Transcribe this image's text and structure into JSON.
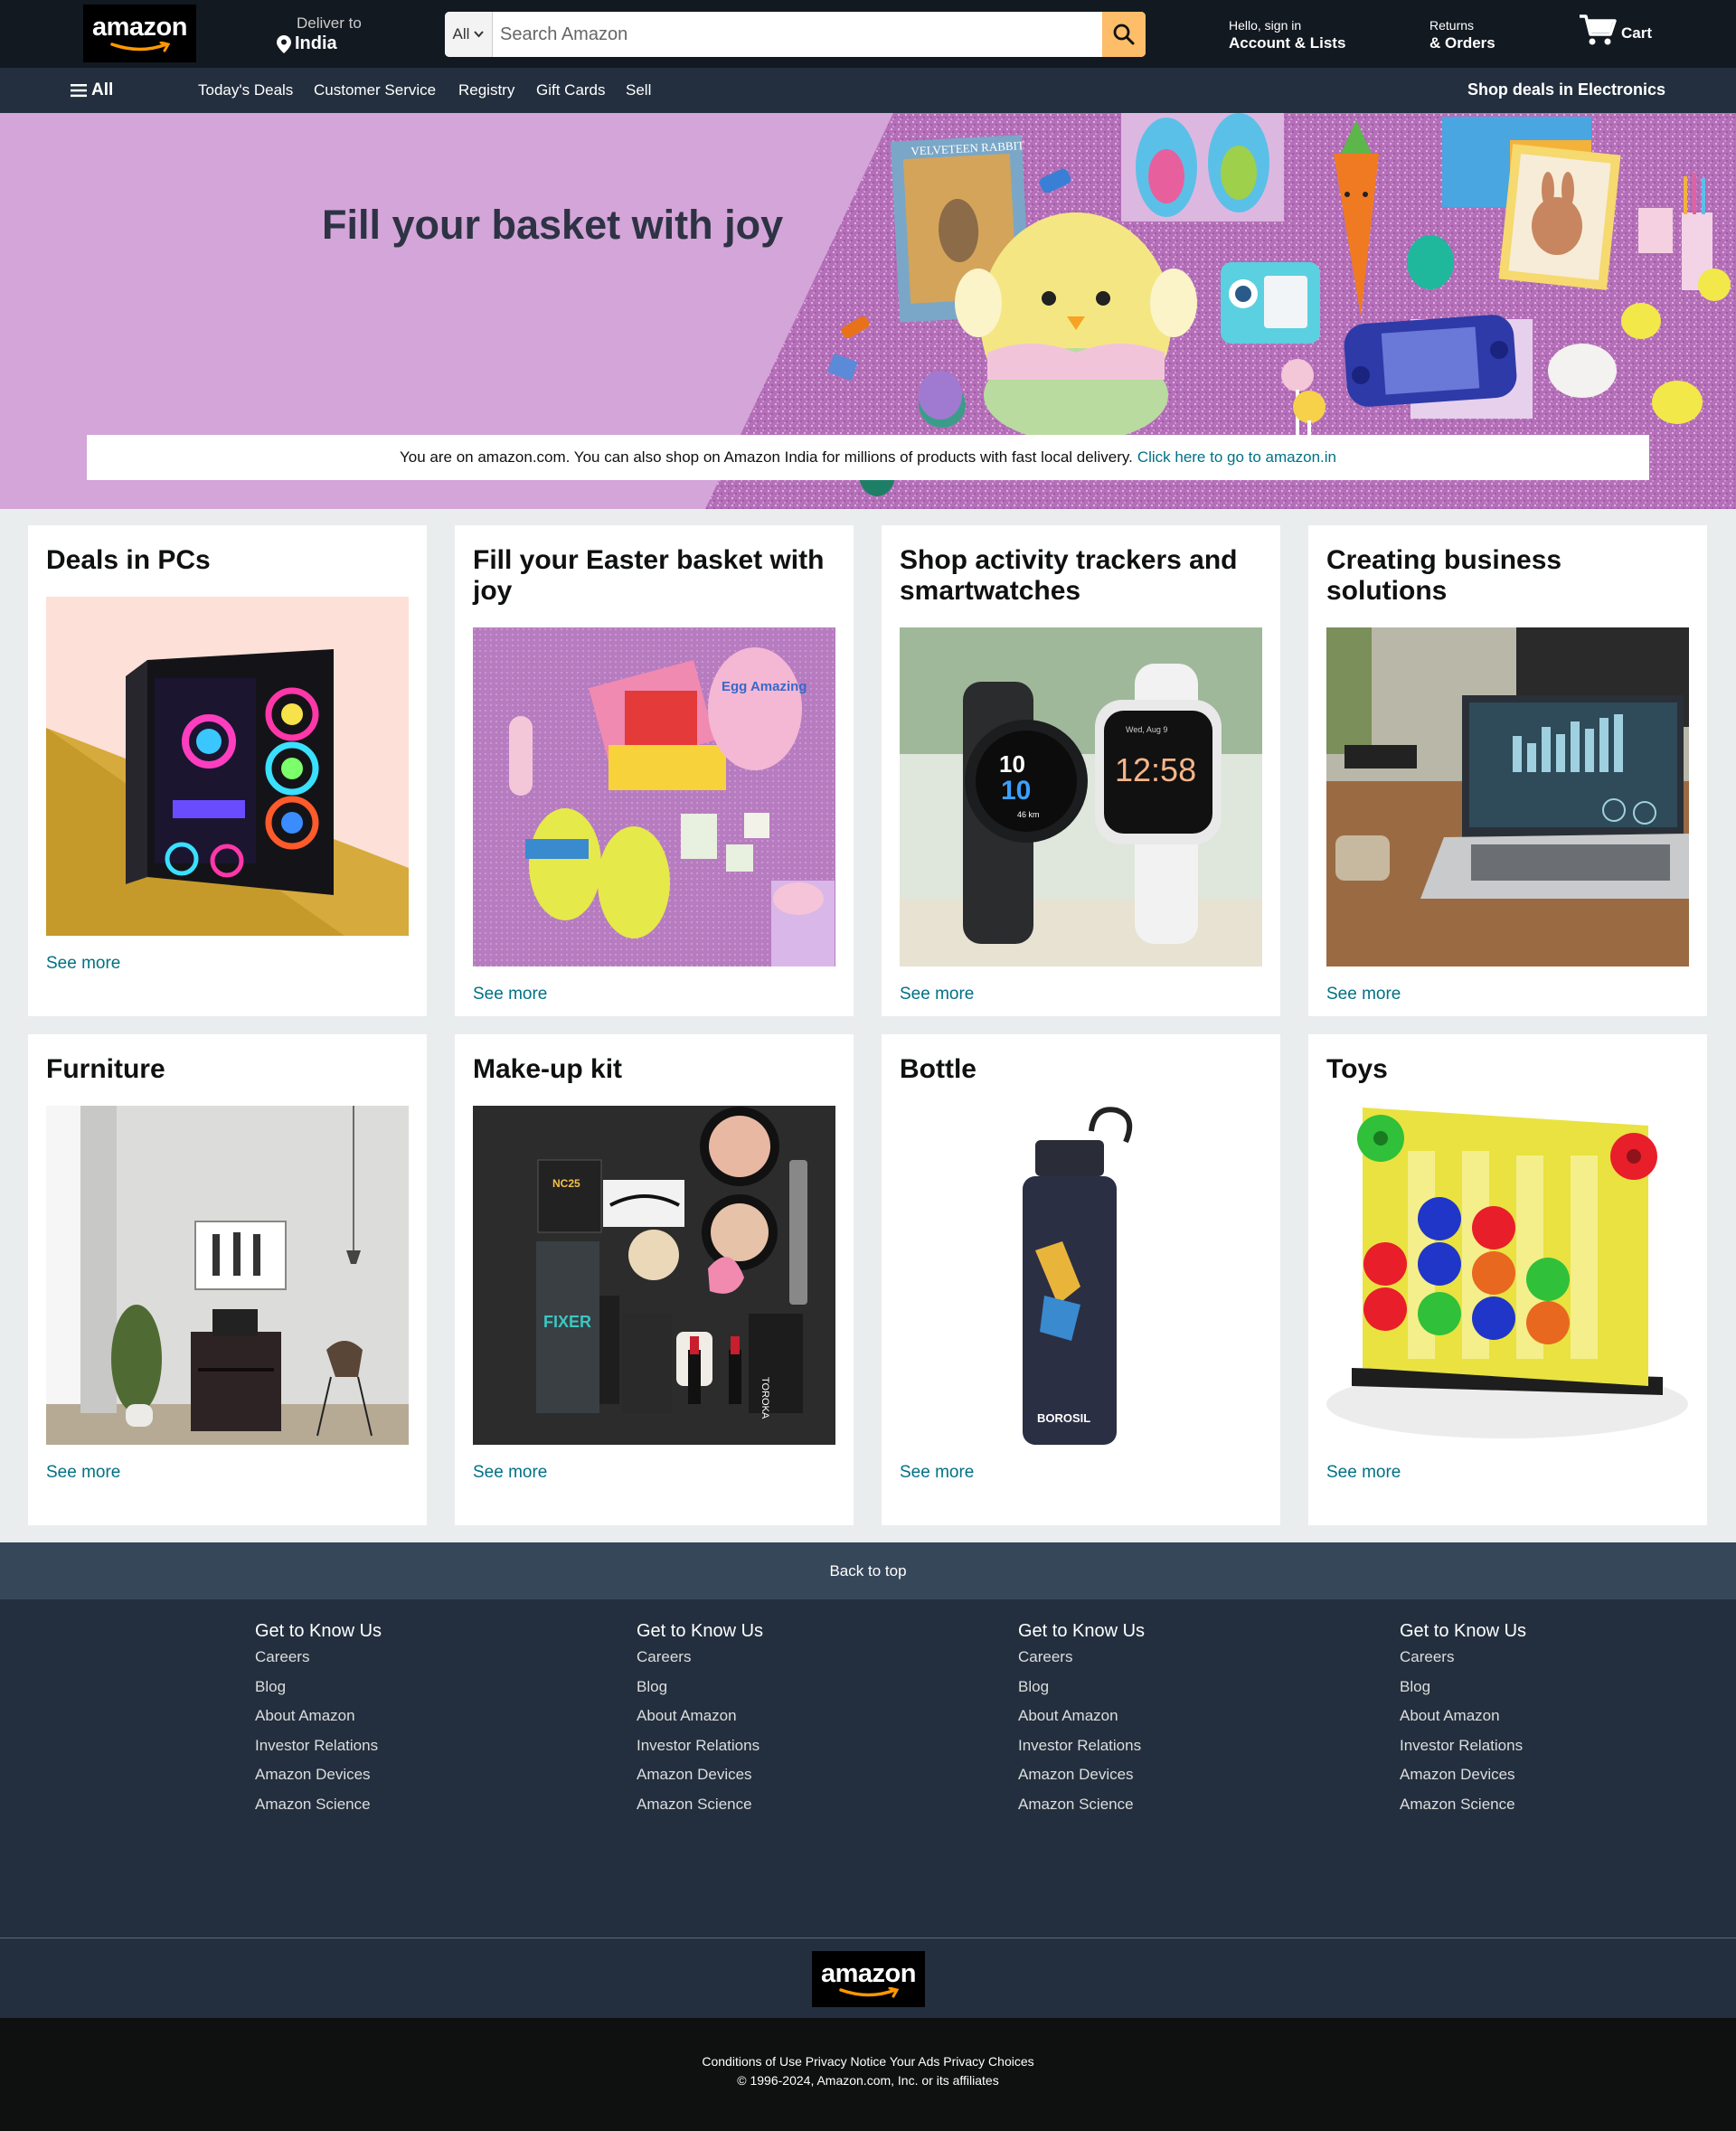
{
  "header": {
    "logo_text": "amazon",
    "deliver_label": "Deliver to",
    "deliver_location": "India",
    "search_category": "All",
    "search_placeholder": "Search Amazon",
    "account_greeting": "Hello, sign in",
    "account_label": "Account & Lists",
    "returns_top": "Returns",
    "returns_bottom": "& Orders",
    "cart_label": "Cart"
  },
  "nav": {
    "all_label": "All",
    "links": [
      "Today's Deals",
      "Customer Service",
      "Registry",
      "Gift Cards",
      "Sell"
    ],
    "promo": "Shop deals in Electronics"
  },
  "hero": {
    "title": "Fill your basket with joy",
    "notice_text": "You are on amazon.com. You can also shop on Amazon India for millions of products with fast local delivery.",
    "notice_link": "Click here to go to amazon.in"
  },
  "cards": [
    {
      "title": "Deals in PCs",
      "more": "See more"
    },
    {
      "title": "Fill your Easter basket with joy",
      "more": "See more"
    },
    {
      "title": "Shop activity trackers and smartwatches",
      "more": "See more"
    },
    {
      "title": "Creating business solutions",
      "more": "See more"
    },
    {
      "title": "Furniture",
      "more": "See more"
    },
    {
      "title": "Make-up kit",
      "more": "See more"
    },
    {
      "title": "Bottle",
      "more": "See more"
    },
    {
      "title": "Toys",
      "more": "See more"
    }
  ],
  "images": {
    "watch1_time": "10",
    "watch1_sub": "10",
    "watch1_km": "46 km",
    "watch2_time": "12:58",
    "watch2_date": "Wed, Aug 9",
    "bottle_brand": "BOROSIL",
    "book_title": "VELVETEEN RABBIT",
    "makeup_fixer": "FIXER",
    "makeup_brand": "TOROKA",
    "makeup_nc": "NC25",
    "easter_egg_text": "Egg Amazing"
  },
  "back_to_top": "Back to top",
  "footer": {
    "columns": [
      {
        "heading": "Get to Know Us",
        "links": [
          "Careers",
          "Blog",
          "About Amazon",
          "Investor Relations",
          "Amazon Devices",
          "Amazon Science"
        ]
      },
      {
        "heading": "Get to Know Us",
        "links": [
          "Careers",
          "Blog",
          "About Amazon",
          "Investor Relations",
          "Amazon Devices",
          "Amazon Science"
        ]
      },
      {
        "heading": "Get to Know Us",
        "links": [
          "Careers",
          "Blog",
          "About Amazon",
          "Investor Relations",
          "Amazon Devices",
          "Amazon Science"
        ]
      },
      {
        "heading": "Get to Know Us",
        "links": [
          "Careers",
          "Blog",
          "About Amazon",
          "Investor Relations",
          "Amazon Devices",
          "Amazon Science"
        ]
      }
    ],
    "logo_text": "amazon",
    "legal_links": "Conditions of Use Privacy Notice Your Ads Privacy Choices",
    "copyright": "© 1996-2024, Amazon.com, Inc. or its affiliates"
  },
  "colors": {
    "header_bg": "#131921",
    "nav_bg": "#232f3e",
    "search_button": "#febd69",
    "link": "#007185",
    "hero_bg": "#d4a5d8",
    "back_to_top_bg": "#37475a"
  }
}
